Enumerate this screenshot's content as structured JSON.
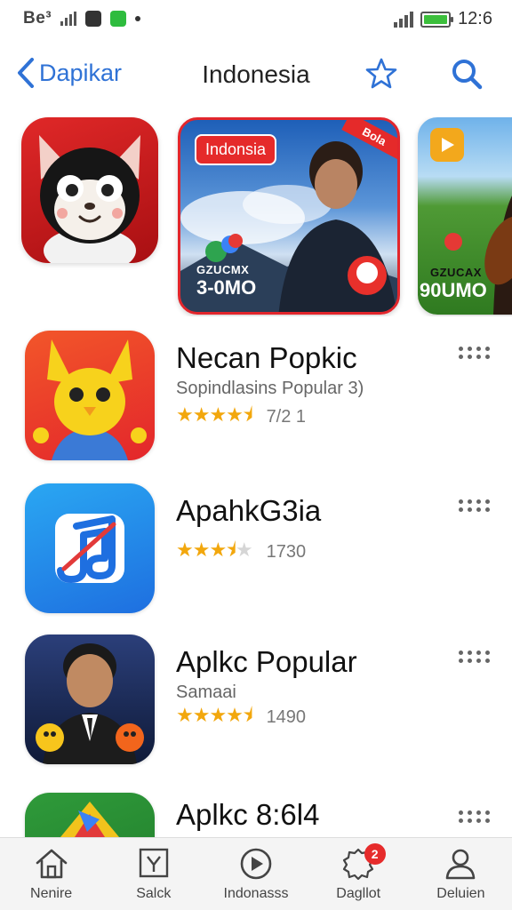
{
  "status_bar": {
    "carrier": "Be³",
    "time": "12:6"
  },
  "nav": {
    "back_label": "Dapikar",
    "title": "Indonesia"
  },
  "featured": {
    "banner1": {
      "tag": "Indonsia",
      "corner": "Bola",
      "subtitle": "GZUCMX",
      "headline": "3-0MO"
    },
    "banner2": {
      "subtitle": "GZUCAX",
      "headline": "90UMO"
    }
  },
  "apps": [
    {
      "name": "Necan Popkic",
      "subtitle": "Sopindlasins Popular 3)",
      "rating": 4.5,
      "rating_count": "7/2 1"
    },
    {
      "name": "ApahkG3ia",
      "subtitle": "",
      "rating": 3.5,
      "rating_count": "1730"
    },
    {
      "name": "Aplkc Popular",
      "subtitle": "Samaai",
      "rating": 4.5,
      "rating_count": "1490"
    },
    {
      "name": "Aplkc 8:6l4",
      "subtitle": "",
      "rating": null,
      "rating_count": ""
    }
  ],
  "tabs": [
    {
      "label": "Nenire",
      "icon": "home-icon"
    },
    {
      "label": "Salck",
      "icon": "box-icon"
    },
    {
      "label": "Indonasss",
      "icon": "play-icon"
    },
    {
      "label": "Dagllot",
      "icon": "badge-icon",
      "badge": "2"
    },
    {
      "label": "Deluien",
      "icon": "person-icon"
    }
  ],
  "colors": {
    "accent": "#2f72d6",
    "star": "#f2a70d",
    "badge": "#e62b2b"
  }
}
